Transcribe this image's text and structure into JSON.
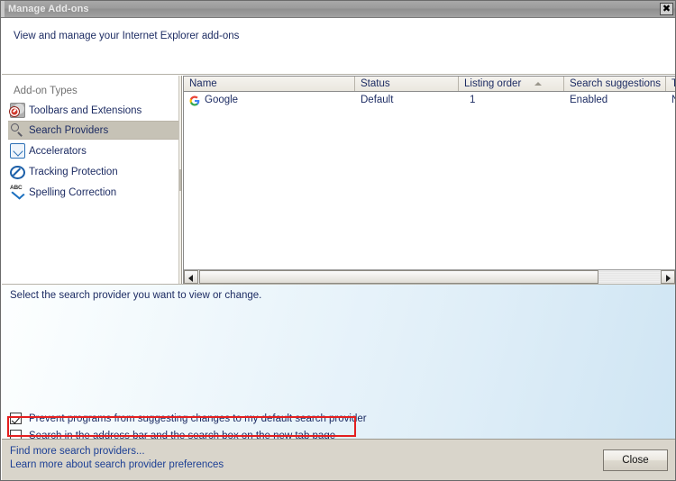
{
  "window": {
    "title": "Manage Add-ons",
    "close_icon": "close-icon",
    "close_symbol": "✖"
  },
  "header": {
    "description": "View and manage your Internet Explorer add-ons"
  },
  "sidebar": {
    "title": "Add-on Types",
    "items": [
      {
        "label": "Toolbars and Extensions",
        "icon": "toolbars-extensions-icon",
        "selected": false
      },
      {
        "label": "Search Providers",
        "icon": "search-magnifier-icon",
        "selected": true
      },
      {
        "label": "Accelerators",
        "icon": "accelerator-icon",
        "selected": false
      },
      {
        "label": "Tracking Protection",
        "icon": "tracking-protection-icon",
        "selected": false
      },
      {
        "label": "Spelling Correction",
        "icon": "spelling-correction-icon",
        "selected": false
      }
    ]
  },
  "table": {
    "columns": [
      {
        "label": "Name",
        "sorted": false
      },
      {
        "label": "Status",
        "sorted": false
      },
      {
        "label": "Listing order",
        "sorted": true,
        "sort_direction": "ascending"
      },
      {
        "label": "Search suggestions",
        "sorted": false
      },
      {
        "label": "To",
        "sorted": false
      }
    ],
    "rows": [
      {
        "icon": "google-logo-icon",
        "name": "Google",
        "status": "Default",
        "listing_order": "1",
        "search_suggestions": "Enabled",
        "last": "No"
      }
    ],
    "scrollbar": {
      "left_arrow": "scroll-left-arrow-icon",
      "right_arrow": "scroll-right-arrow-icon"
    }
  },
  "lower": {
    "description": "Select the search provider you want to view or change.",
    "checkboxes": [
      {
        "label": "Prevent programs from suggesting changes to my default search provider",
        "checked": true,
        "highlighted": false
      },
      {
        "label": "Search in the address bar and the search box on the new tab page",
        "checked": false,
        "highlighted": true
      }
    ]
  },
  "footer": {
    "links": [
      "Find more search providers...",
      "Learn more about search provider preferences"
    ],
    "close_button": "Close"
  },
  "colors": {
    "titlebar": "#9b9b9b",
    "selection": "#c6c2b6",
    "link": "#1c3f94",
    "text": "#1d2c63",
    "highlight_red": "#e31f1f",
    "footer_bg": "#d9d5cb",
    "lower_gradient_start": "#fdffff",
    "lower_gradient_end": "#cfe5f3"
  }
}
